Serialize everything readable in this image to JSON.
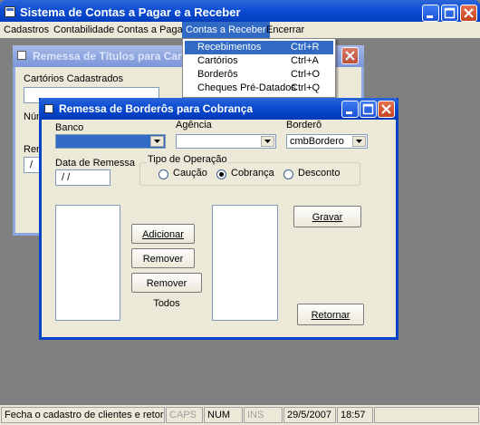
{
  "app": {
    "title": "Sistema de Contas a Pagar e a Receber"
  },
  "menubar": {
    "items": [
      "Cadastros",
      "Contabilidade",
      "Contas a Pagar",
      "Contas a Receber",
      "Encerrar"
    ]
  },
  "dropdown": {
    "items": [
      {
        "label": "Recebimentos",
        "shortcut": "Ctrl+R"
      },
      {
        "label": "Cartórios",
        "shortcut": "Ctrl+A"
      },
      {
        "label": "Borderôs",
        "shortcut": "Ctrl+O"
      },
      {
        "label": "Cheques Pré-Datados",
        "shortcut": "Ctrl+Q"
      }
    ]
  },
  "bg_window": {
    "title": "Remessa de Títulos para Cartó",
    "label_cartorios": "Cartórios Cadastrados",
    "label_num": "Núm",
    "label_rem": "Rem",
    "field_value": "/"
  },
  "dialog": {
    "title": "Remessa de Borderôs para Cobrança",
    "label_banco": "Banco",
    "label_agencia": "Agência",
    "label_bordero": "Borderô",
    "bordero_value": "cmbBordero",
    "label_data": "Data de Remessa",
    "data_value": "/ /",
    "group_title": "Tipo de Operação",
    "radio_caucao": "Caução",
    "radio_cobranca": "Cobrança",
    "radio_desconto": "Desconto",
    "btn_adicionar": "Adicionar",
    "btn_remover": "Remover",
    "btn_remover_todos": "Remover Todos",
    "btn_gravar": "Gravar",
    "btn_retornar": "Retornar"
  },
  "status": {
    "message": "Fecha o cadastro de clientes e retorna à j",
    "caps": "CAPS",
    "num": "NUM",
    "ins": "INS",
    "date": "29/5/2007",
    "time": "18:57"
  }
}
